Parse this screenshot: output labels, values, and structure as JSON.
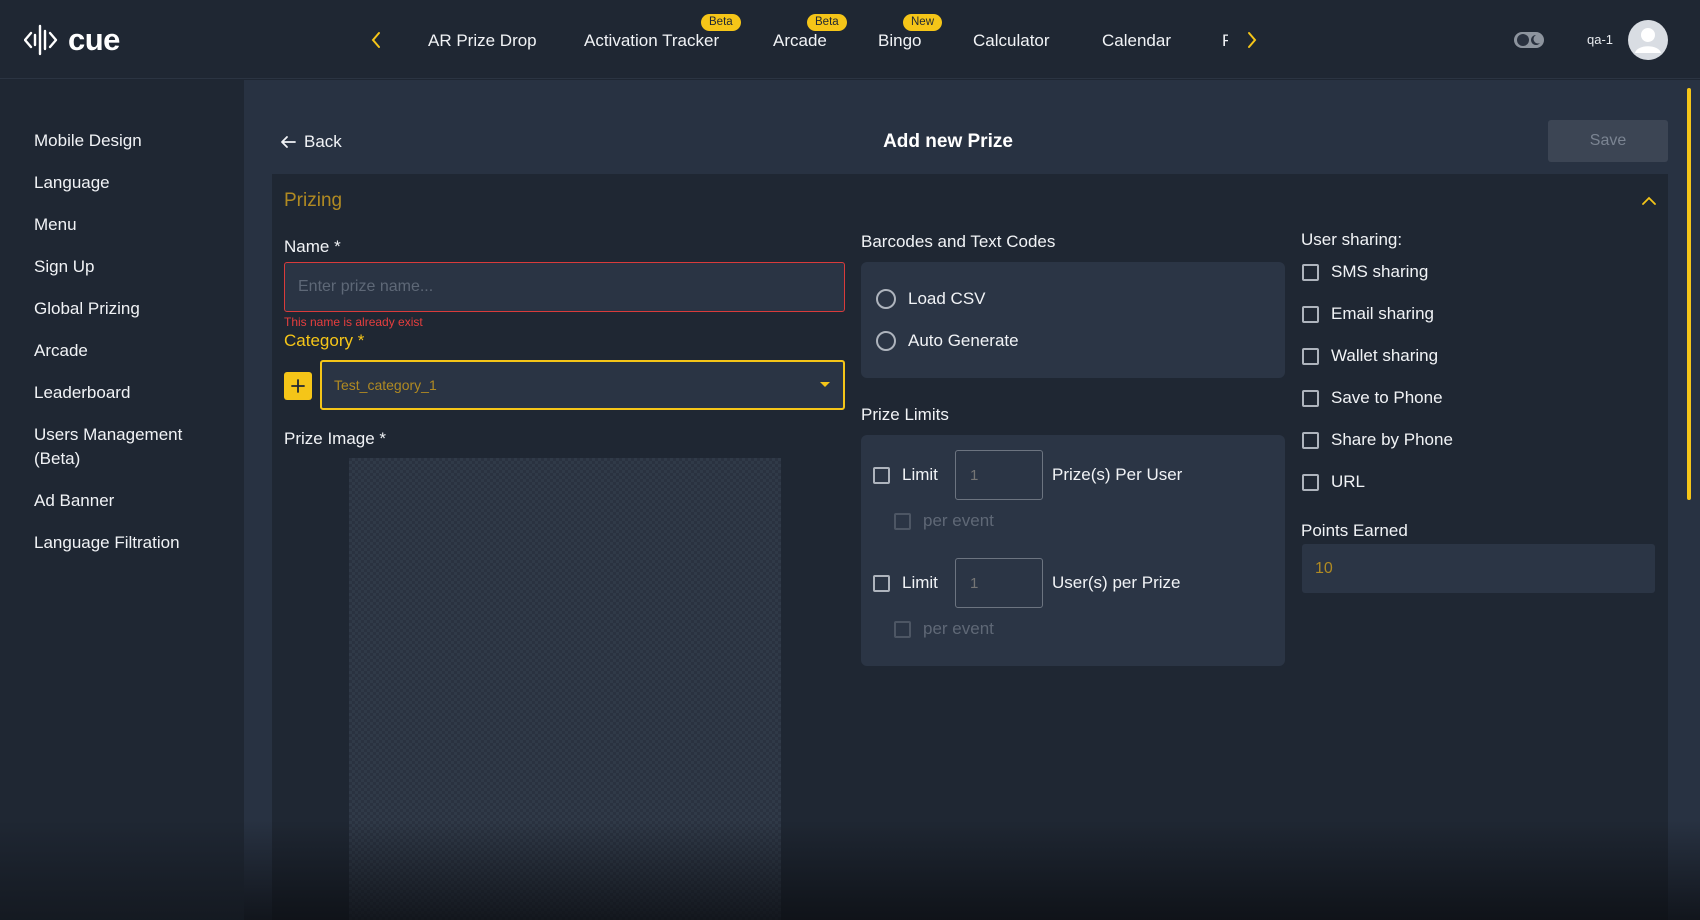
{
  "header": {
    "logo_text": "cue",
    "tabs": [
      {
        "label": "AR Prize Drop",
        "badge": ""
      },
      {
        "label": "Activation Tracker",
        "badge": "Beta"
      },
      {
        "label": "Arcade",
        "badge": "Beta"
      },
      {
        "label": "Bingo",
        "badge": "New"
      },
      {
        "label": "Calculator",
        "badge": ""
      },
      {
        "label": "Calendar",
        "badge": ""
      },
      {
        "label": "F",
        "badge": ""
      }
    ],
    "user_name": "qa-1",
    "icons": {
      "prev": "chevron-left-icon",
      "next": "chevron-right-icon",
      "theme": "theme-toggle-icon",
      "avatar": "user-avatar-icon"
    }
  },
  "sidebar": {
    "items": [
      {
        "label": "Mobile Design"
      },
      {
        "label": "Language"
      },
      {
        "label": "Menu"
      },
      {
        "label": "Sign Up"
      },
      {
        "label": "Global Prizing"
      },
      {
        "label": "Arcade"
      },
      {
        "label": "Leaderboard"
      },
      {
        "label": "Users Management (Beta)"
      },
      {
        "label": "Ad Banner"
      },
      {
        "label": "Language Filtration"
      }
    ]
  },
  "page": {
    "back_label": "Back",
    "title": "Add new Prize",
    "save_label": "Save"
  },
  "prizing": {
    "section_title": "Prizing",
    "name_label": "Name *",
    "name_placeholder": "Enter prize name...",
    "name_value": "",
    "name_error": "This name is already exist",
    "category_label": "Category *",
    "category_value": "Test_category_1",
    "prize_image_label": "Prize Image *"
  },
  "codes": {
    "title": "Barcodes and Text Codes",
    "options": [
      {
        "label": "Load CSV",
        "selected": false
      },
      {
        "label": "Auto Generate",
        "selected": false
      }
    ]
  },
  "limits": {
    "title": "Prize Limits",
    "rows": [
      {
        "check_label": "Limit",
        "placeholder": "1",
        "unit": "Prize(s) Per User",
        "sub_label": "per event"
      },
      {
        "check_label": "Limit",
        "placeholder": "1",
        "unit": "User(s) per Prize",
        "sub_label": "per event"
      }
    ]
  },
  "sharing": {
    "title": "User sharing:",
    "options": [
      {
        "label": "SMS sharing",
        "checked": false
      },
      {
        "label": "Email sharing",
        "checked": false
      },
      {
        "label": "Wallet sharing",
        "checked": false
      },
      {
        "label": "Save to Phone",
        "checked": false
      },
      {
        "label": "Share by Phone",
        "checked": false
      },
      {
        "label": "URL",
        "checked": false
      }
    ],
    "points_label": "Points Earned",
    "points_value": "10"
  },
  "colors": {
    "accent": "#f5c518",
    "section_title": "#b08a22",
    "error": "#e53e3e",
    "background": "#1f2733",
    "main_bg": "#283242"
  }
}
